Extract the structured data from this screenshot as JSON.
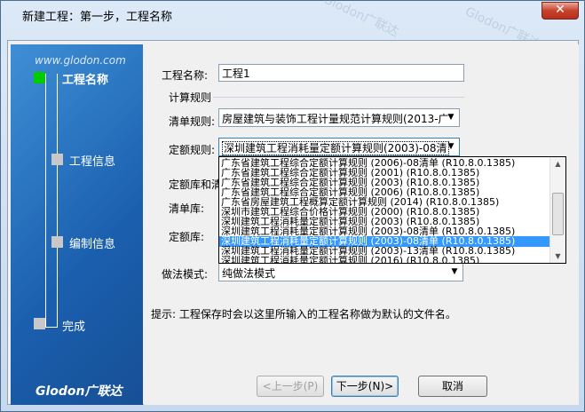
{
  "window": {
    "title": "新建工程：第一步，工程名称",
    "close_symbol": "✕"
  },
  "watermark": "Glodon广联达",
  "sidebar": {
    "site": "www.glodon.com",
    "logo": "Glodon广联达",
    "steps": [
      {
        "label": "工程名称",
        "active": true
      },
      {
        "label": "工程信息",
        "active": false
      },
      {
        "label": "编制信息",
        "active": false
      },
      {
        "label": "完成",
        "active": false
      }
    ]
  },
  "form": {
    "project_name_label": "工程名称:",
    "project_name_value": "工程1",
    "rules_group_label": "计算规则",
    "list_rule_label": "清单规则:",
    "list_rule_value": "房屋建筑与装饰工程计量规范计算规则(2013-广",
    "quota_rule_label": "定额规则:",
    "quota_rule_value": "深圳建筑工程消耗量定额计算规则(2003)-08清",
    "db_group_label": "定额库和清",
    "list_db_label": "清单库:",
    "quota_db_label": "定额库:",
    "method_label": "做法模式:",
    "method_value": "纯做法模式",
    "hint": "提示: 工程保存时会以这里所输入的工程名称做为默认的文件名。"
  },
  "dropdown": {
    "selected_index": 8,
    "options": [
      "广东省建筑工程综合定额计算规则 (2006)-08清单 (R10.8.0.1385)",
      "广东省建筑工程综合定额计算规则 (2001) (R10.8.0.1385)",
      "广东省建筑工程综合定额计算规则 (2003) (R10.8.0.1385)",
      "广东省建筑工程综合定额计算规则 (2006) (R10.8.0.1385)",
      "广东省房屋建筑工程概算定额计算规则 (2014) (R10.8.0.1385)",
      "深圳市建筑工程综合价格计算规则 (2000) (R10.8.0.1385)",
      "深圳建筑工程消耗量定额计算规则 (2003) (R10.8.0.1385)",
      "深圳建筑工程消耗量定额计算规则 (2003)-08清单 (R10.8.0.1385)",
      "深圳建筑工程消耗量定额计算规则 (2003)-08清单 (R10.8.0.1385)",
      "深圳建筑工程消耗量定额计算规则 (2003)-13清单 (R10.8.0.1385)",
      "深圳建筑工程消耗量定额计算规则 (2016) (R10.8.0.1385)"
    ],
    "scroll_up": "▲",
    "scroll_down": "▼"
  },
  "buttons": {
    "prev": "<上一步(P)",
    "next": "下一步(N)>",
    "cancel": "取消"
  },
  "colors": {
    "active_step": "#00cc00",
    "inactive_step": "#c8c8c8",
    "selection": "#3399ff"
  }
}
